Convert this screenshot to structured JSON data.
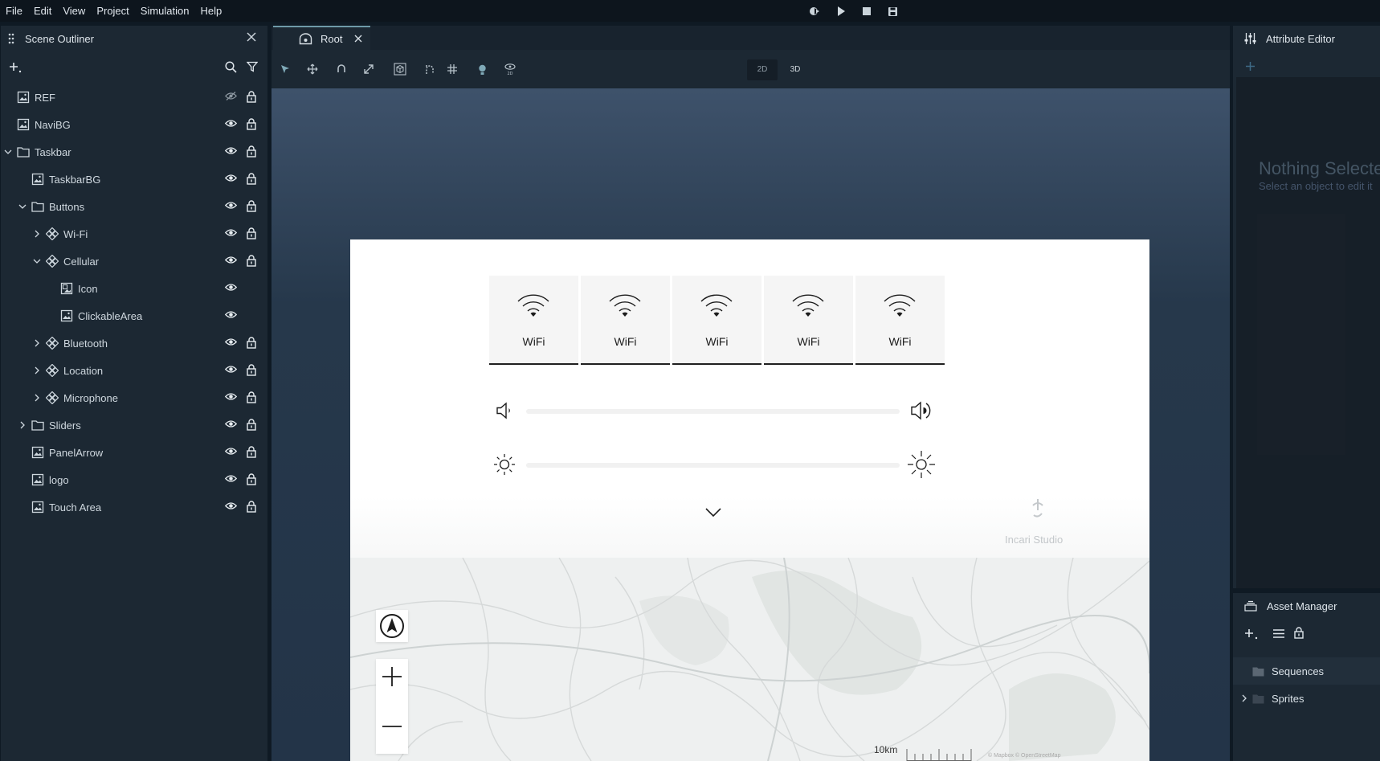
{
  "menu": [
    "File",
    "Edit",
    "View",
    "Project",
    "Simulation",
    "Help"
  ],
  "outliner": {
    "title": "Scene Outliner",
    "items": [
      {
        "label": "REF",
        "type": "image",
        "level": 0,
        "hidden": true
      },
      {
        "label": "NaviBG",
        "type": "image",
        "level": 0
      },
      {
        "label": "Taskbar",
        "type": "folder",
        "level": 0,
        "expanded": true
      },
      {
        "label": "TaskbarBG",
        "type": "image",
        "level": 1
      },
      {
        "label": "Buttons",
        "type": "folder",
        "level": 1,
        "expanded": true
      },
      {
        "label": "Wi-Fi",
        "type": "component",
        "level": 2,
        "expanded": false
      },
      {
        "label": "Cellular",
        "type": "component",
        "level": 2,
        "expanded": true
      },
      {
        "label": "Icon",
        "type": "icon",
        "level": 3,
        "no_lock": true
      },
      {
        "label": "ClickableArea",
        "type": "image",
        "level": 3,
        "no_lock": true
      },
      {
        "label": "Bluetooth",
        "type": "component",
        "level": 2,
        "expanded": false
      },
      {
        "label": "Location",
        "type": "component",
        "level": 2,
        "expanded": false
      },
      {
        "label": "Microphone",
        "type": "component",
        "level": 2,
        "expanded": false
      },
      {
        "label": "Sliders",
        "type": "folder",
        "level": 1,
        "expanded": false
      },
      {
        "label": "PanelArrow",
        "type": "image",
        "level": 1
      },
      {
        "label": "logo",
        "type": "image",
        "level": 1
      },
      {
        "label": "Touch Area",
        "type": "image",
        "level": 1
      }
    ]
  },
  "viewport": {
    "tab_label": "Root",
    "mode_2d": "2D",
    "mode_3d": "3D",
    "tiles": [
      "WiFi",
      "WiFi",
      "WiFi",
      "WiFi",
      "WiFi"
    ],
    "watermark": "Incari Studio",
    "map_scale": "10km",
    "map_credit": "© Mapbox © OpenStreetMap"
  },
  "attribute_editor": {
    "title": "Attribute Editor",
    "nothing_title": "Nothing Selected",
    "nothing_sub": "Select an object to edit it"
  },
  "asset_manager": {
    "title": "Asset Manager",
    "items": [
      {
        "label": "Sequences",
        "expanded": null
      },
      {
        "label": "Sprites",
        "expanded": false
      }
    ]
  },
  "colors": {
    "accent": "#6e9aa8",
    "panel": "#1c2833",
    "canvas": "#26384b"
  }
}
